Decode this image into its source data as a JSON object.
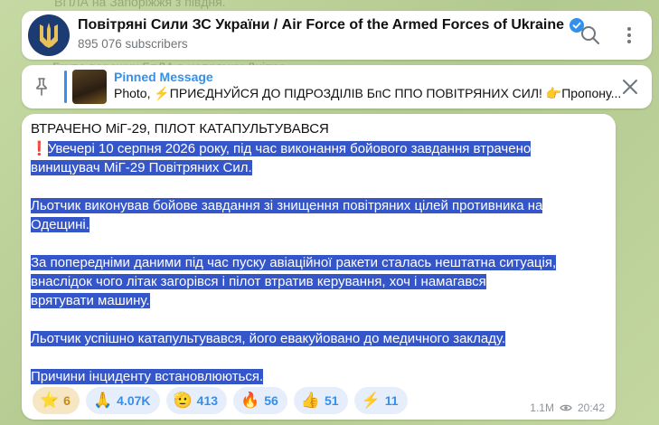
{
  "background": {
    "top_text": "ВПЛА на Запоріжжя з півдня.",
    "mid_text": "Група ворожих БпЛА в напрямку Дніпра"
  },
  "header": {
    "channel_name": "Повітряні Сили ЗС України / Air Force of the Armed Forces of Ukraine",
    "subscribers": "895 076 subscribers"
  },
  "pinned": {
    "label": "Pinned Message",
    "text": "Photo, ⚡ПРИЄДНУЙСЯ ДО ПІДРОЗДІЛІВ БпС ППО ПОВІТРЯНИХ СИЛ! 👉Пропону..."
  },
  "message": {
    "heading": "ВТРАЧЕНО МіГ-29, ПІЛОТ КАТАПУЛЬТУВАВСЯ",
    "exclamation": "❗",
    "p1_line1": "Увечері 10 серпня 2026 року, під час виконання бойового завдання втрачено",
    "p1_line2": "винищувач МіГ-29 Повітряних Сил.",
    "p2_line1": "Льотчик виконував бойове завдання зі знищення повітряних цілей противника на",
    "p2_line2": "Одещині.",
    "p3_line1": "За попередніми даними під час пуску авіаційної ракети сталась нештатна ситуація,",
    "p3_line2": "внаслідок чого літак загорівся і пілот втратив керування, хоч і намагався",
    "p3_line3": "врятувати машину.",
    "p4": "Льотчик успішно катапультувався, його евакуйовано до медичного закладу.",
    "p5": "Причини інциденту встановлюються.",
    "views": "1.1M",
    "time": "20:42"
  },
  "reactions": [
    {
      "emoji": "⭐",
      "count": "6"
    },
    {
      "emoji": "🙏",
      "count": "4.07K"
    },
    {
      "emoji": "🫡",
      "count": "413"
    },
    {
      "emoji": "🔥",
      "count": "56"
    },
    {
      "emoji": "👍",
      "count": "51"
    },
    {
      "emoji": "⚡",
      "count": "11"
    }
  ],
  "colors": {
    "accent": "#3390ec",
    "selection": "#3556c9",
    "star_reaction": "#c78a14"
  }
}
